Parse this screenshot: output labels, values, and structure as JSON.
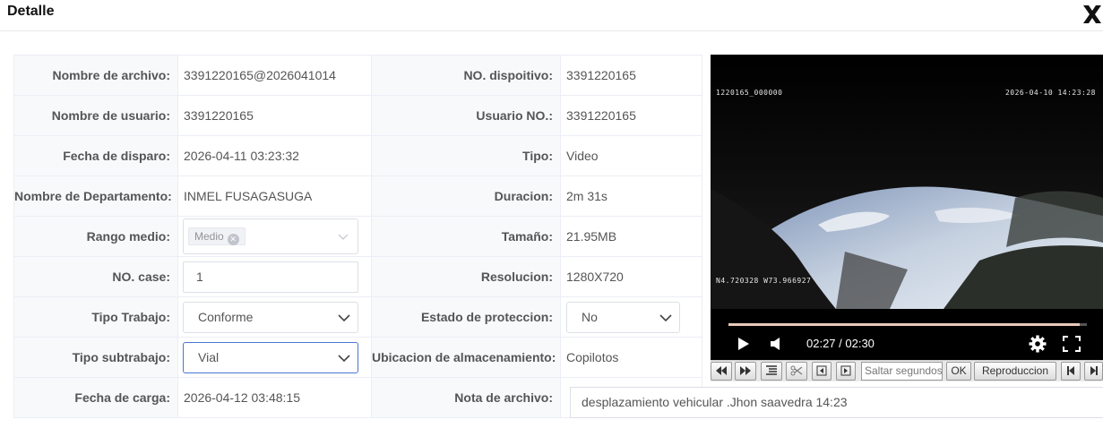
{
  "dialog": {
    "title": "Detalle"
  },
  "rows": [
    {
      "l1": "Nombre de archivo:",
      "v1": "3391220165@2026041014",
      "l2": "NO. dispoitivo:",
      "v2": "3391220165"
    },
    {
      "l1": "Nombre de usuario:",
      "v1": "3391220165",
      "l2": "Usuario NO.:",
      "v2": "3391220165"
    },
    {
      "l1": "Fecha de disparo:",
      "v1": "2026-04-11 03:23:32",
      "l2": "Tipo:",
      "v2": "Video"
    },
    {
      "l1": "Nombre de Departamento:",
      "v1": "INMEL FUSAGASUGA",
      "l2": "Duracion:",
      "v2": "2m 31s"
    },
    {
      "l1": "Rango medio:",
      "v1": "Medio",
      "l2": "Tamaño:",
      "v2": "21.95MB"
    },
    {
      "l1": "NO. case:",
      "v1": "1",
      "l2": "Resolucion:",
      "v2": "1280X720"
    },
    {
      "l1": "Tipo Trabajo:",
      "v1": "Conforme",
      "l2": "Estado de proteccion:",
      "v2": "No"
    },
    {
      "l1": "Tipo subtrabajo:",
      "v1": "Vial",
      "l2": "Ubicacion de almacenamiento:",
      "v2": "Copilotos"
    },
    {
      "l1": "Fecha de carga:",
      "v1": "2026-04-12 03:48:15",
      "l2": "Nota de archivo:",
      "v2": "desplazamiento vehicular .Jhon saavedra 14:23"
    }
  ],
  "video": {
    "osd_left": "1220165_000000",
    "osd_right": "2026-04-10 14:23:28",
    "osd_gps": "N4.720328 W73.966927",
    "time": "02:27 / 02:30",
    "progress": 0.98
  },
  "toolbar": {
    "seek_placeholder": "Saltar segundos",
    "ok_label": "OK",
    "playback_label": "Reproduccion"
  }
}
